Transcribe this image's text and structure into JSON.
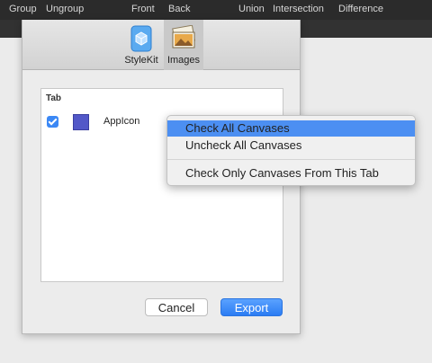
{
  "toolbar": {
    "group": "Group",
    "ungroup": "Ungroup",
    "front": "Front",
    "back": "Back",
    "union": "Union",
    "intersection": "Intersection",
    "difference": "Difference"
  },
  "sheet": {
    "tabs": [
      {
        "label": "StyleKit",
        "icon": "stylekit-cube-icon"
      },
      {
        "label": "Images",
        "icon": "images-photo-icon",
        "active": true
      }
    ],
    "panel_title": "Tab",
    "items": [
      {
        "label": "AppIcon",
        "checked": true,
        "swatch_color": "#5258c8"
      }
    ],
    "cancel_label": "Cancel",
    "export_label": "Export"
  },
  "context_menu": {
    "items": [
      {
        "label": "Check All Canvases",
        "highlighted": true
      },
      {
        "label": "Uncheck All Canvases"
      },
      {
        "label": "Check Only Canvases From This Tab"
      }
    ]
  },
  "colors": {
    "accent": "#3b88f5",
    "highlight": "#4c8ff2"
  }
}
